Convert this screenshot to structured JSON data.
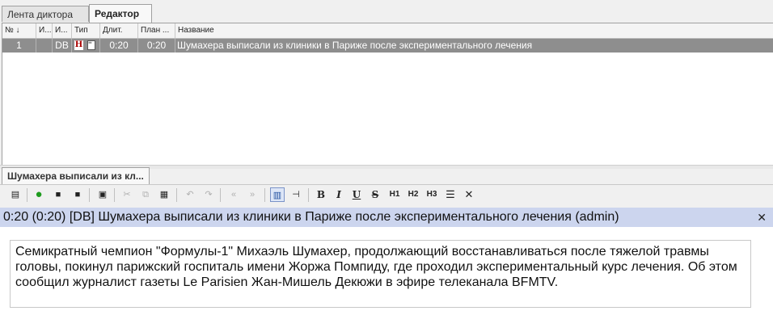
{
  "tabs": [
    {
      "label": "Лента диктора",
      "active": false
    },
    {
      "label": "Редактор",
      "active": true
    }
  ],
  "grid": {
    "headers": [
      "№",
      "И...",
      "И...",
      "Тип",
      "Длит.",
      "План ...",
      "Название"
    ],
    "rows": [
      {
        "num": "1",
        "c2": "",
        "c3": "DB",
        "type_icons": [
          "H",
          "doc"
        ],
        "duration": "0:20",
        "planned": "0:20",
        "name": "Шумахера выписали из клиники в Париже после экспериментального лечения"
      }
    ]
  },
  "document_tab": {
    "label": "Шумахера выписали из кл..."
  },
  "toolbar": {
    "items": [
      {
        "icon": "document-icon",
        "glyph": "▤",
        "enabled": true
      },
      {
        "icon": "check-icon",
        "glyph": "●",
        "enabled": true,
        "color": "#1e9b1e"
      },
      {
        "icon": "save-icon",
        "glyph": "■",
        "enabled": true
      },
      {
        "icon": "save-as-icon",
        "glyph": "■",
        "enabled": true
      },
      {
        "icon": "export-icon",
        "glyph": "▣",
        "enabled": true
      },
      {
        "icon": "cut-icon",
        "glyph": "✂",
        "enabled": false
      },
      {
        "icon": "copy-icon",
        "glyph": "⧉",
        "enabled": false
      },
      {
        "icon": "paste-icon",
        "glyph": "▦",
        "enabled": true
      },
      {
        "icon": "undo-icon",
        "glyph": "↶",
        "enabled": false
      },
      {
        "icon": "redo-icon",
        "glyph": "↷",
        "enabled": false
      },
      {
        "icon": "prev-icon",
        "glyph": "«",
        "enabled": false
      },
      {
        "icon": "next-icon",
        "glyph": "»",
        "enabled": false
      },
      {
        "icon": "layout-icon",
        "glyph": "▥",
        "enabled": true,
        "color": "#1f4f9f"
      },
      {
        "icon": "pin-icon",
        "glyph": "⊣",
        "enabled": true
      },
      {
        "icon": "bold-icon",
        "glyph": "B",
        "enabled": true
      },
      {
        "icon": "italic-icon",
        "glyph": "I",
        "enabled": true
      },
      {
        "icon": "underline-icon",
        "glyph": "U",
        "enabled": true
      },
      {
        "icon": "strikethrough-icon",
        "glyph": "S",
        "enabled": true
      },
      {
        "icon": "heading1-icon",
        "glyph": "H1",
        "enabled": true
      },
      {
        "icon": "heading2-icon",
        "glyph": "H2",
        "enabled": true
      },
      {
        "icon": "heading3-icon",
        "glyph": "H3",
        "enabled": true
      },
      {
        "icon": "list-icon",
        "glyph": "☰",
        "enabled": true
      },
      {
        "icon": "clear-format-icon",
        "glyph": "✕",
        "enabled": true
      }
    ]
  },
  "story": {
    "header": "0:20 (0:20)  [DB] Шумахера выписали из клиники в Париже после экспериментального лечения (admin)",
    "close_glyph": "✕",
    "body": "Семикратный чемпион \"Формулы-1\" Михаэль Шумахер, продолжающий восстанавливаться после тяжелой травмы головы, покинул парижский госпиталь имени Жоржа Помпиду, где проходил экспериментальный курс лечения. Об этом сообщил журналист газеты Le Parisien Жан-Мишель Декюжи в эфире телеканала BFMTV."
  },
  "colors": {
    "selected_row": "#8e8e8e",
    "title_bar": "#ccd5ee",
    "accent_green": "#1e9b1e"
  }
}
